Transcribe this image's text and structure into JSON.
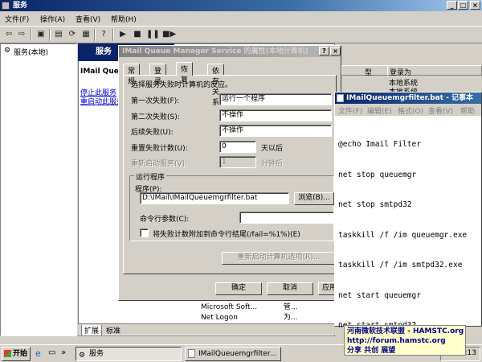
{
  "window": {
    "title": "服务"
  },
  "menubar": {
    "items": [
      "文件(F)",
      "操作(A)",
      "查看(V)",
      "帮助(H)"
    ]
  },
  "tree": {
    "root_label": "服务(本地)"
  },
  "services_panel": {
    "header": "服务",
    "service_name": "IMail Queue",
    "stop_link": "停止此服务",
    "restart_link": "重启动此服务",
    "columns": {
      "type": "型",
      "logon": "登录为"
    },
    "logon_values": [
      "本地系统",
      "本地系统"
    ],
    "rows": [
      {
        "name": "Microsoft Soft...",
        "status": "管..."
      },
      {
        "name": "Net Logon",
        "status": "为..."
      }
    ],
    "bottom_tabs": [
      "扩展",
      "标准"
    ]
  },
  "dialog": {
    "title": "IMail Queue Manager Service 的属性(本地计算机)",
    "title_help": "?",
    "tabs": [
      "常规",
      "登录",
      "恢复",
      "依存关系"
    ],
    "active_tab": "恢复",
    "intro": "选择服务失败时计算机的反应。",
    "first_failure_label": "第一次失败(F):",
    "first_failure_value": "运行一个程序",
    "second_failure_label": "第二次失败(S):",
    "second_failure_value": "不操作",
    "subsequent_failure_label": "后续失败(U):",
    "subsequent_failure_value": "不操作",
    "reset_count_label": "重置失败计数(U):",
    "reset_count_value": "0",
    "reset_count_unit": "天以后",
    "restart_service_label": "重新启动服务(V):",
    "restart_service_value": "1",
    "restart_service_unit": "分钟后",
    "run_program_group": "运行程序",
    "program_label": "程序(P):",
    "program_value": "D:\\IMail\\IMailQueuemgrfilter.bat",
    "browse_button": "浏览(B)...",
    "params_label": "命令行参数(C):",
    "params_value": "",
    "append_checkbox_label": "将失败计数附加到命令行结尾(/fail=%1%)(E)",
    "restart_computer_button": "重新启动计算机选项(R)...",
    "ok_button": "确定",
    "cancel_button": "取消",
    "apply_button": "应用"
  },
  "notepad": {
    "title": "IMailQueuemgrfilter.bat - 记事本",
    "menu": [
      "文件(F)",
      "编辑(E)",
      "格式(O)",
      "查看(V)",
      "帮助"
    ],
    "lines": [
      "@echo Imail Filter",
      "net stop queuemgr",
      "net stop smtpd32",
      "taskkill /f /im queuemgr.exe",
      "taskkill /f /im smtpd32.exe",
      "net start queuemgr",
      "net start smtpd32"
    ]
  },
  "taskbar": {
    "start_label": "开始",
    "tasks": [
      {
        "label": "服务",
        "active": true
      },
      {
        "label": "IMailQueuemgrfilter...",
        "active": false
      }
    ],
    "clock": "9:13"
  },
  "watermark": {
    "line1": "河南微软技术联盟 - HAMSTC.org",
    "line2": "http://forum.hamstc.org",
    "line3": "分享 共创 展望"
  }
}
